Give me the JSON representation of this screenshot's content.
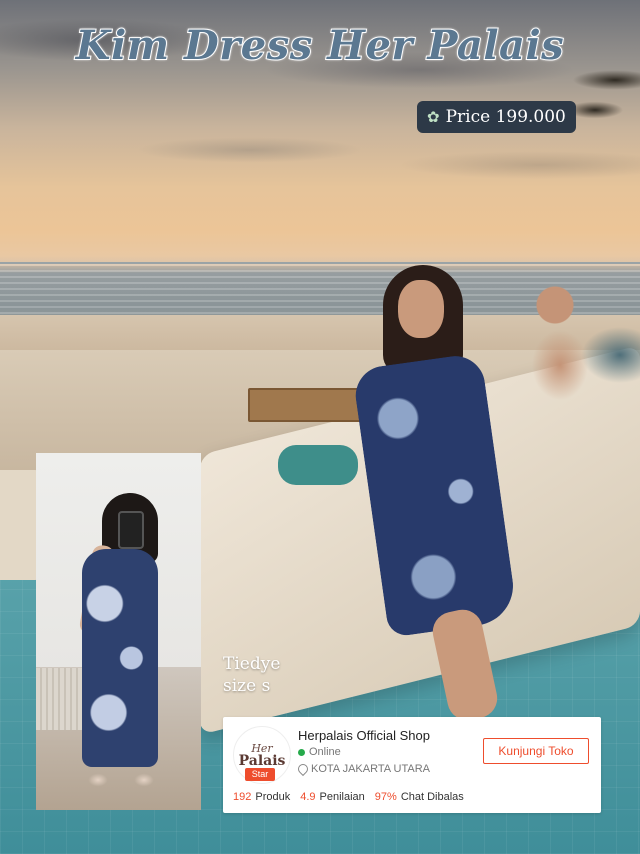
{
  "header": {
    "title": "Kim Dress Her Palais",
    "price_icon": "flower-icon",
    "price_text": "Price 199.000"
  },
  "caption": {
    "line1": "Tiedye",
    "line2": "size s"
  },
  "shop": {
    "logo_line1": "Her",
    "logo_line2": "Palais",
    "badge": "Star",
    "name": "Herpalais Official Shop",
    "status": "Online",
    "location": "KOTA JAKARTA UTARA",
    "visit_button": "Kunjungi Toko",
    "stats": [
      {
        "value": "192",
        "label": "Produk"
      },
      {
        "value": "4.9",
        "label": "Penilaian"
      },
      {
        "value": "97%",
        "label": "Chat Dibalas"
      }
    ]
  },
  "colors": {
    "accent": "#ee4d2d",
    "online": "#26aa4b",
    "price_bg": "#2d3947",
    "title_fill": "#5b7891"
  }
}
